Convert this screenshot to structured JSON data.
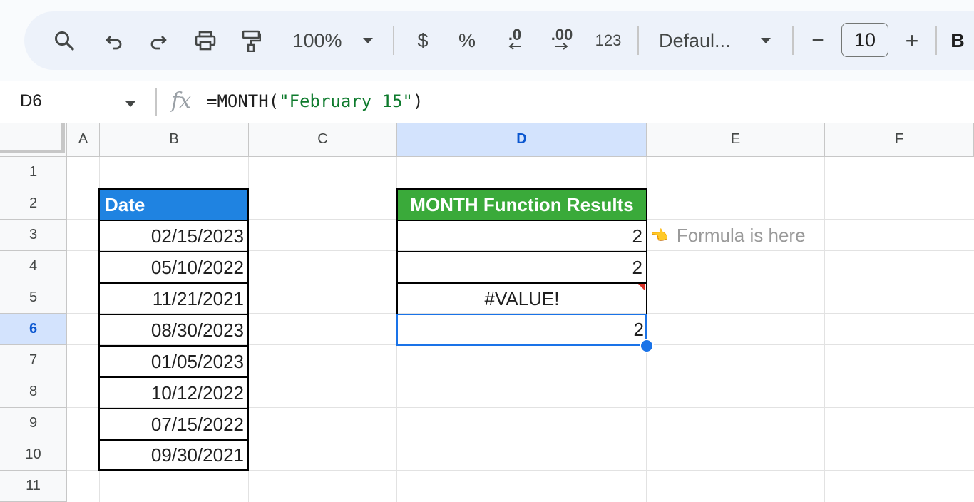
{
  "toolbar": {
    "zoom": "100%",
    "currency": "$",
    "percent": "%",
    "decrease_decimal": ".0",
    "increase_decimal": ".00",
    "number_format": "123",
    "font": "Defaul...",
    "font_size": "10",
    "minus": "−",
    "plus": "+",
    "bold": "B"
  },
  "formula_bar": {
    "cell_ref": "D6",
    "fx": "fx",
    "formula_prefix": "=MONTH(",
    "formula_string": "\"February 15\"",
    "formula_suffix": ")"
  },
  "columns": [
    "A",
    "B",
    "C",
    "D",
    "E",
    "F"
  ],
  "rows": [
    "1",
    "2",
    "3",
    "4",
    "5",
    "6",
    "7",
    "8",
    "9",
    "10",
    "11"
  ],
  "selected": {
    "column": "D",
    "row": "6"
  },
  "date_header": "Date",
  "dates": [
    "02/15/2023",
    "05/10/2022",
    "11/21/2021",
    "08/30/2023",
    "01/05/2023",
    "10/12/2022",
    "07/15/2022",
    "09/30/2021"
  ],
  "results_header": "MONTH Function Results",
  "results": [
    "2",
    "2",
    "#VALUE!",
    "2"
  ],
  "note": {
    "icon": "👈",
    "text": "Formula is here"
  },
  "colors": {
    "date_header": "#1f83e1",
    "results_header": "#3aaa3a",
    "selection": "#1a73e8"
  }
}
